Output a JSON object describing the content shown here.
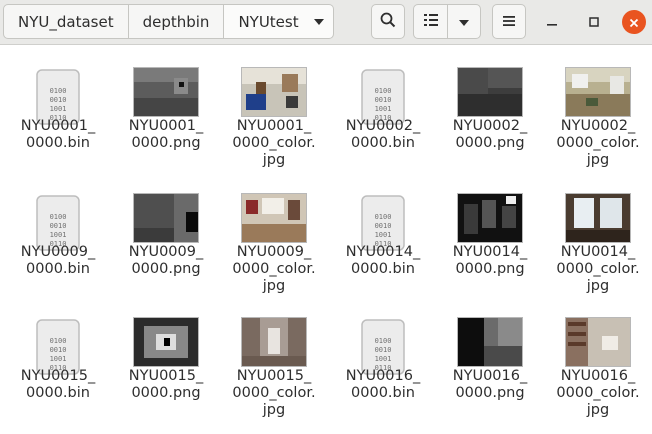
{
  "window": {
    "breadcrumbs": [
      "NYU_dataset",
      "depthbin",
      "NYUtest"
    ],
    "icons": {
      "search": "search-icon",
      "view": "list-view-icon",
      "view_options": "chevron-down-icon",
      "menu": "hamburger-menu-icon",
      "minimize": "minimize-icon",
      "maximize": "maximize-icon",
      "close": "close-icon"
    },
    "colors": {
      "close_button": "#e95420",
      "headerbar": "#e9e9e7"
    }
  },
  "files": [
    {
      "name": "NYU0001_\n0000.bin",
      "type": "bin"
    },
    {
      "name": "NYU0001_\n0000.png",
      "type": "depth",
      "variant": 1
    },
    {
      "name": "NYU0001_\n0000_color.\njpg",
      "type": "photo",
      "variant": 1
    },
    {
      "name": "NYU0002_\n0000.bin",
      "type": "bin"
    },
    {
      "name": "NYU0002_\n0000.png",
      "type": "depth",
      "variant": 2
    },
    {
      "name": "NYU0002_\n0000_color.\njpg",
      "type": "photo",
      "variant": 2
    },
    {
      "name": "NYU0009_\n0000.bin",
      "type": "bin"
    },
    {
      "name": "NYU0009_\n0000.png",
      "type": "depth",
      "variant": 3
    },
    {
      "name": "NYU0009_\n0000_color.\njpg",
      "type": "photo",
      "variant": 3
    },
    {
      "name": "NYU0014_\n0000.bin",
      "type": "bin"
    },
    {
      "name": "NYU0014_\n0000.png",
      "type": "depth",
      "variant": 4
    },
    {
      "name": "NYU0014_\n0000_color.\njpg",
      "type": "photo",
      "variant": 4
    },
    {
      "name": "NYU0015_\n0000.bin",
      "type": "bin"
    },
    {
      "name": "NYU0015_\n0000.png",
      "type": "depth",
      "variant": 5
    },
    {
      "name": "NYU0015_\n0000_color.\njpg",
      "type": "photo",
      "variant": 5
    },
    {
      "name": "NYU0016_\n0000.bin",
      "type": "bin"
    },
    {
      "name": "NYU0016_\n0000.png",
      "type": "depth",
      "variant": 6
    },
    {
      "name": "NYU0016_\n0000_color.\njpg",
      "type": "photo",
      "variant": 6
    }
  ]
}
